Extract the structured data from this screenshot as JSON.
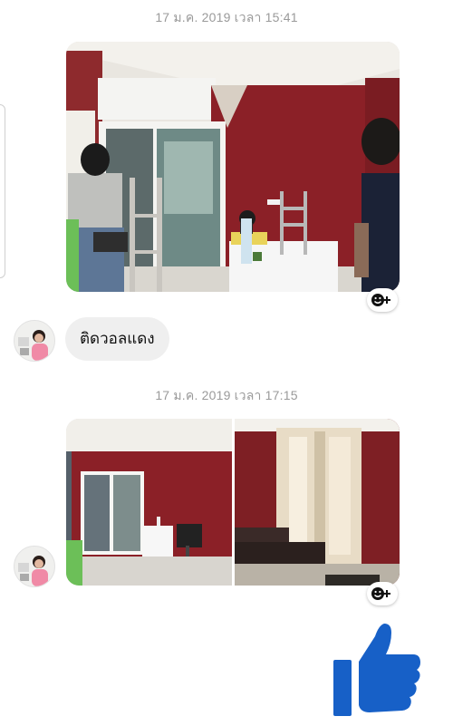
{
  "chat": {
    "messages": [
      {
        "type": "timestamp",
        "text": "17 ม.ค. 2019 เวลา 15:41"
      },
      {
        "type": "text",
        "text": "ติดวอลแดง"
      },
      {
        "type": "timestamp",
        "text": "17 ม.ค. 2019 เวลา 17:15"
      }
    ],
    "reaction_symbol": "+"
  },
  "icons": {
    "react": "smiley-add-icon",
    "like": "thumbs-up-icon",
    "avatar": "contact-avatar"
  },
  "colors": {
    "timestamp": "#9a9a9a",
    "bubble": "#efefef",
    "like": "#1760c7",
    "wall": "#8b2027"
  }
}
